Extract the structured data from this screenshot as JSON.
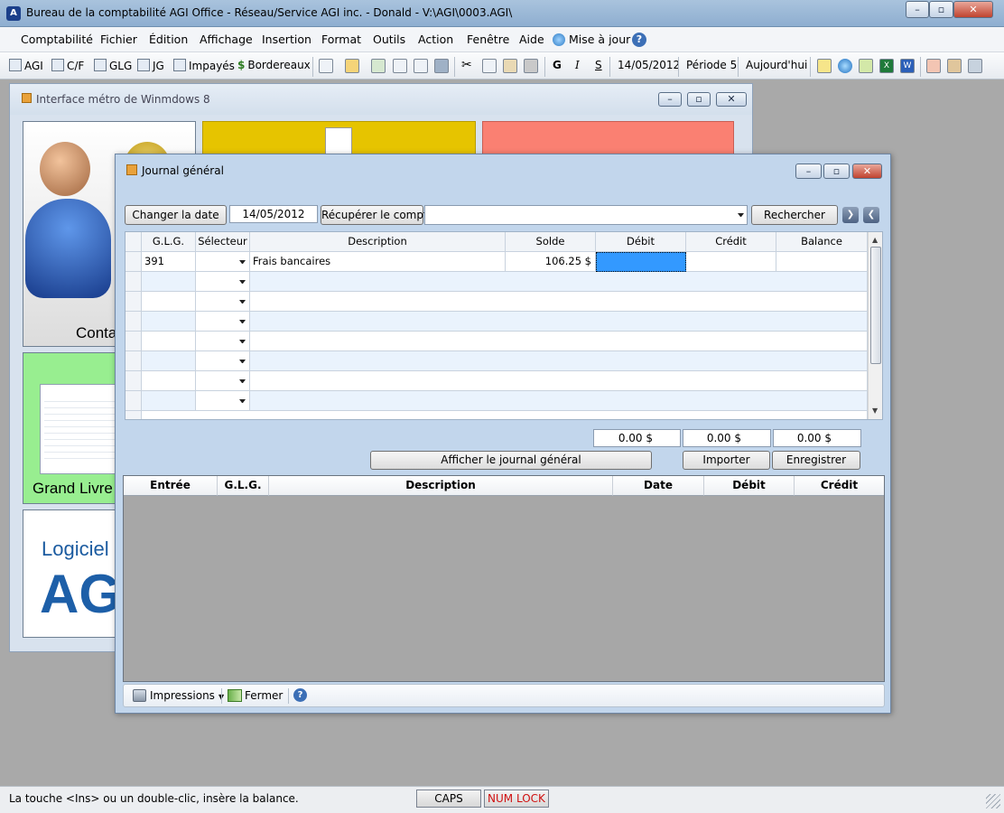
{
  "window": {
    "title": "Bureau de la comptabilité AGI Office - Réseau/Service AGI inc. - Donald - V:\\AGI\\0003.AGI\\"
  },
  "menu": [
    "Comptabilité",
    "Fichier",
    "Édition",
    "Affichage",
    "Insertion",
    "Format",
    "Outils",
    "Action",
    "Fenêtre",
    "Aide",
    "Mise à jour"
  ],
  "toolbar": {
    "agi": "AGI",
    "cf": "C/F",
    "glg": "GLG",
    "jg": "JG",
    "impayes": "Impayés",
    "bordereaux": "Bordereaux",
    "bold": "G",
    "italic": "I",
    "underline": "S",
    "date": "14/05/2012",
    "periode": "Période 5",
    "today": "Aujourd'hui"
  },
  "metro": {
    "title": "Interface métro de Winmdows 8",
    "tile1": "Conta",
    "tile2": "Grand Livre",
    "tile3a": "Logiciel",
    "tile3b": "AG",
    "colors": {
      "yellow": "#e6c400",
      "salmon": "#fa8072",
      "green": "#98ee90"
    }
  },
  "journal": {
    "title": "Journal général",
    "change_date": "Changer la date",
    "date": "14/05/2012",
    "recover": "Récupérer le compte",
    "search": "Rechercher",
    "columns": [
      "G.L.G.",
      "Sélecteur",
      "Description",
      "Solde",
      "Débit",
      "Crédit",
      "Balance"
    ],
    "rows": [
      {
        "glg": "391",
        "desc": "Frais bancaires",
        "solde": "106.25 $"
      }
    ],
    "totals": {
      "debit": "0.00 $",
      "credit": "0.00 $",
      "balance": "0.00 $"
    },
    "show_journal": "Afficher le journal général",
    "import": "Importer",
    "save": "Enregistrer",
    "columns2": [
      "Entrée",
      "G.L.G.",
      "Description",
      "Date",
      "Débit",
      "Crédit"
    ],
    "print": "Impressions",
    "close": "Fermer"
  },
  "status": {
    "hint": "La touche <Ins> ou un double-clic, insère la balance.",
    "caps": "CAPS",
    "numlock": "NUM LOCK"
  }
}
